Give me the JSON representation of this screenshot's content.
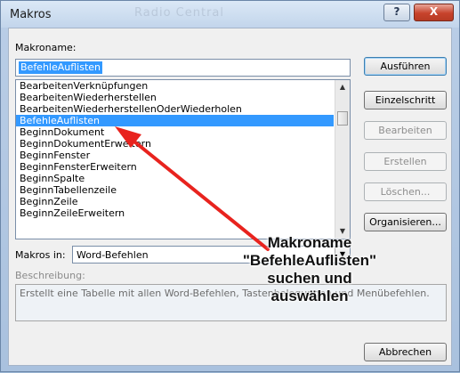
{
  "window": {
    "title": "Makros",
    "background_title": "Radio Central",
    "help_glyph": "?",
    "close_glyph": "X"
  },
  "form": {
    "macro_name_label": "Makroname:",
    "macro_name_value": "BefehleAuflisten",
    "macros_in_label": "Makros in:",
    "macros_in_value": "Word-Befehlen",
    "description_label": "Beschreibung:",
    "description_text": "Erstellt eine Tabelle mit allen Word-Befehlen, Tastenbelegungen und Menübefehlen."
  },
  "list": {
    "items": [
      "BearbeitenVerknüpfungen",
      "BearbeitenWiederherstellen",
      "BearbeitenWiederherstellenOderWiederholen",
      "BefehleAuflisten",
      "BeginnDokument",
      "BeginnDokumentErweitern",
      "BeginnFenster",
      "BeginnFensterErweitern",
      "BeginnSpalte",
      "BeginnTabellenzeile",
      "BeginnZeile",
      "BeginnZeileErweitern"
    ],
    "selected_index": 3
  },
  "buttons": {
    "run": "Ausführen",
    "step": "Einzelschritt",
    "edit": "Bearbeiten",
    "create": "Erstellen",
    "delete": "Löschen...",
    "organize": "Organisieren...",
    "cancel": "Abbrechen"
  },
  "annotation": {
    "lines": [
      "Makroname",
      "\"BefehleAuflisten\"",
      "suchen und",
      "auswählen"
    ]
  },
  "colors": {
    "selection": "#3399ff",
    "arrow": "#e8231e"
  },
  "icons": {
    "scroll_up": "triangle-up",
    "scroll_down": "triangle-down",
    "dropdown": "triangle-down"
  }
}
